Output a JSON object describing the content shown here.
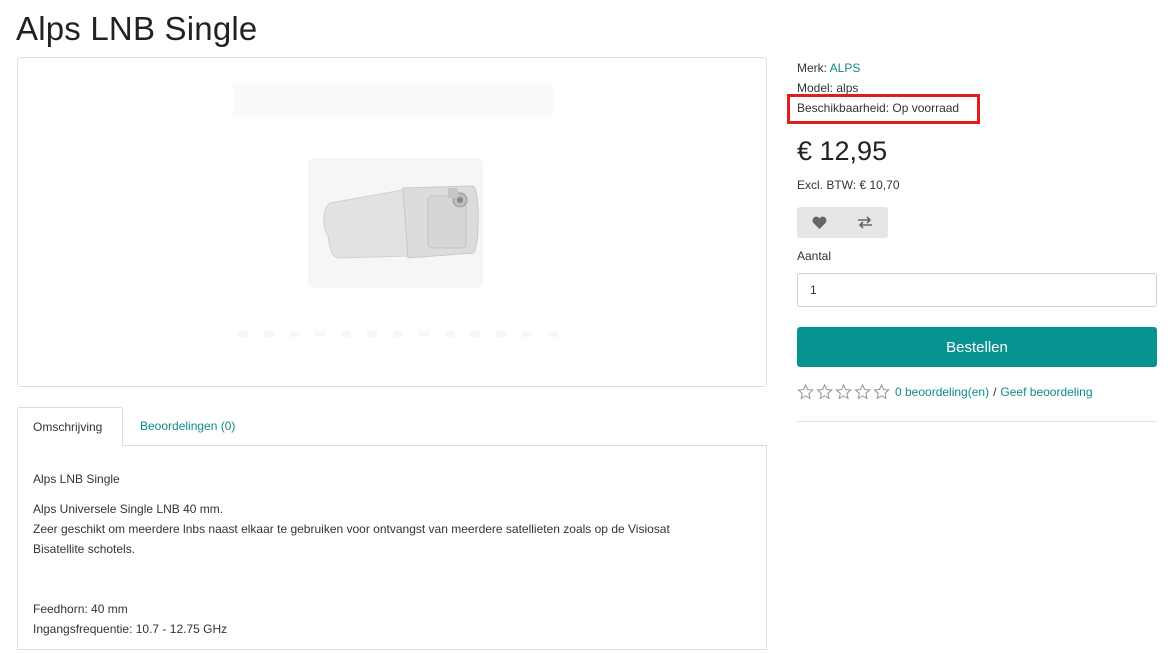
{
  "product": {
    "title": "Alps LNB Single",
    "brand_label": "Merk:",
    "brand_value": "ALPS",
    "model_label": "Model:",
    "model_value": "alps",
    "availability": "Beschikbaarheid: Op voorraad",
    "price": "€ 12,95",
    "excl_tax": "Excl. BTW: € 10,70",
    "quantity_label": "Aantal",
    "quantity_value": "1",
    "order_button": "Bestellen"
  },
  "actions": {
    "wishlist_icon": "heart-icon",
    "compare_icon": "exchange-icon"
  },
  "rating": {
    "stars": 0,
    "reviews_link": "0 beoordeling(en)",
    "separator": "/",
    "write_review_link": "Geef beoordeling"
  },
  "tabs": [
    {
      "label": "Omschrijving"
    },
    {
      "label": "Beoordelingen (0)"
    }
  ],
  "description": {
    "heading": "Alps LNB Single",
    "line1": "Alps Universele Single LNB 40 mm.",
    "line2": "Zeer geschikt om meerdere lnbs naast elkaar te gebruiken voor ontvangst van meerdere satellieten zoals op de Visiosat",
    "line3": "Bisatellite schotels.",
    "spec1": "Feedhorn: 40 mm",
    "spec2": "Ingangsfrequentie: 10.7 - 12.75 GHz"
  },
  "colors": {
    "accent": "#079490",
    "link": "#0f8a8a",
    "highlight": "#e01e1e"
  }
}
